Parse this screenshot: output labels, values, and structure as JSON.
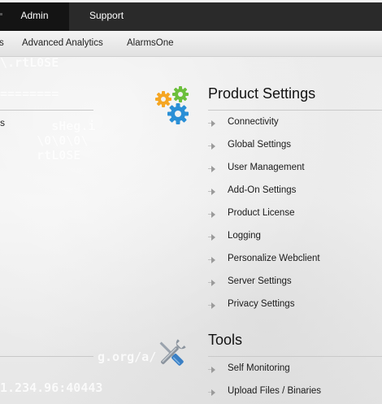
{
  "topnav": {
    "tabs": [
      {
        "label": "Admin",
        "active": true
      },
      {
        "label": "Support",
        "active": false
      }
    ]
  },
  "subnav": {
    "items": [
      "s",
      "Advanced Analytics",
      "AlarmsOne"
    ]
  },
  "left": {
    "partial_text": "s"
  },
  "product_settings": {
    "title": "Product Settings",
    "icon": "gears-icon",
    "items": [
      "Connectivity",
      "Global Settings",
      "User Management",
      "Add-On Settings",
      "Product License",
      "Logging",
      "Personalize Webclient",
      "Server Settings",
      "Privacy Settings"
    ]
  },
  "tools": {
    "title": "Tools",
    "icon": "wrench-screwdriver-icon",
    "items": [
      "Self Monitoring",
      "Upload Files / Binaries"
    ]
  },
  "colors": {
    "topnav_bg": "#2a2a2a",
    "active_tab_bg": "#141414",
    "gear_orange": "#f5a623",
    "gear_green": "#6cbf3c",
    "gear_blue": "#2a8fd6"
  }
}
